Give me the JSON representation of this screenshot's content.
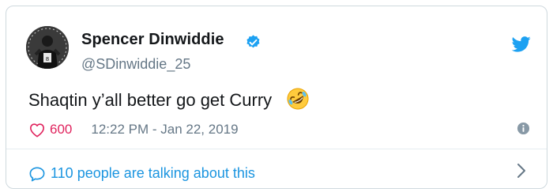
{
  "author": {
    "display_name": "Spencer Dinwiddie",
    "handle": "@SDinwiddie_25"
  },
  "tweet": {
    "text": "Shaqtin y’all better go get Curry",
    "emoji": "rolling-on-the-floor-laughing",
    "likes": "600",
    "timestamp": "12:22 PM - Jan 22, 2019"
  },
  "footer": {
    "conversation_label": "110 people are talking about this"
  },
  "icons": {
    "verified": "verified-badge-icon",
    "brand": "twitter-bird-icon",
    "like": "heart-icon",
    "info": "info-icon",
    "reply": "speech-bubble-icon",
    "chevron": "chevron-right-icon"
  },
  "colors": {
    "brand_blue": "#1da1f2",
    "link_blue": "#1b95e0",
    "like_pink": "#e0245e",
    "muted_gray": "#657786",
    "text_dark": "#14171a",
    "border": "#cfd9de"
  }
}
